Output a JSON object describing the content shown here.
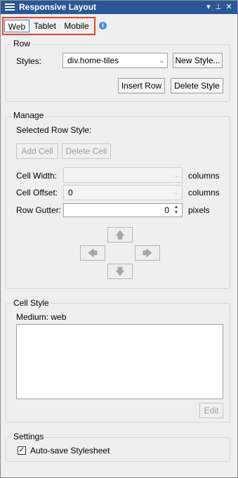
{
  "window": {
    "title": "Responsive Layout",
    "pin_icon": "pin-icon",
    "close_icon": "close-icon",
    "dropdown_icon": "chevron-down-icon"
  },
  "tabs": [
    {
      "label": "Web",
      "active": true
    },
    {
      "label": "Tablet",
      "active": false
    },
    {
      "label": "Mobile",
      "active": false
    }
  ],
  "row": {
    "group_label": "Row",
    "styles_label": "Styles:",
    "styles_value": "div.home-tiles",
    "new_style_label": "New Style...",
    "insert_row_label": "Insert Row",
    "delete_style_label": "Delete Style"
  },
  "manage": {
    "group_label": "Manage",
    "selected_row_style_label": "Selected Row Style:",
    "add_cell_label": "Add Cell",
    "delete_cell_label": "Delete Cell",
    "cell_width_label": "Cell Width:",
    "cell_width_value": "",
    "cell_width_unit": "columns",
    "cell_offset_label": "Cell Offset:",
    "cell_offset_value": "0",
    "cell_offset_unit": "columns",
    "row_gutter_label": "Row Gutter:",
    "row_gutter_value": "0",
    "row_gutter_unit": "pixels"
  },
  "cell_style": {
    "group_label": "Cell Style",
    "medium_label": "Medium: web",
    "edit_label": "Edit"
  },
  "settings": {
    "group_label": "Settings",
    "autosave_label": "Auto-save Stylesheet",
    "autosave_checked": true
  }
}
